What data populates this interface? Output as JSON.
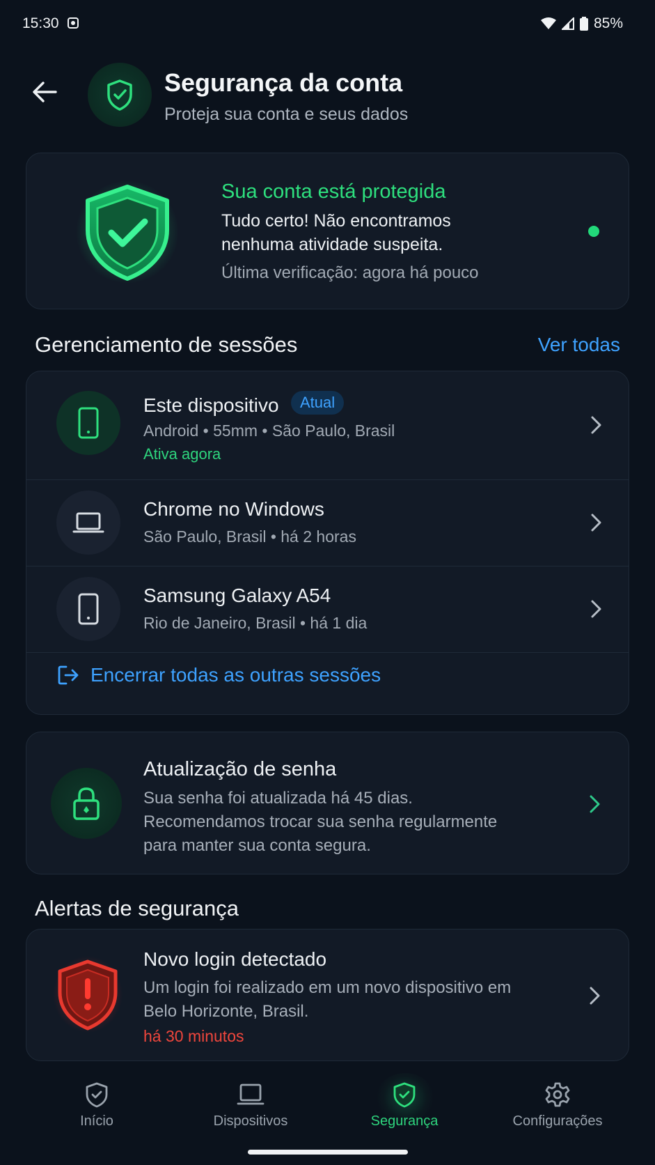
{
  "status_bar": {
    "time": "15:30",
    "battery": "85%"
  },
  "header": {
    "title": "Segurança da conta",
    "subtitle": "Proteja sua conta e seus dados"
  },
  "protection": {
    "title": "Sua conta está protegida",
    "body": "Tudo certo! Não encontramos nenhuma atividade suspeita.",
    "last_check": "Última verificação: agora há pouco"
  },
  "sessions": {
    "title": "Gerenciamento de sessões",
    "see_all": "Ver todas",
    "items": [
      {
        "name": "Este dispositivo",
        "badge": "Atual",
        "meta": "Android • 55mm • São Paulo, Brasil",
        "status": "Ativa agora",
        "icon": "smartphone-icon"
      },
      {
        "name": "Chrome no Windows",
        "meta": "São Paulo, Brasil • há 2 horas",
        "icon": "laptop-icon"
      },
      {
        "name": "Samsung Galaxy A54",
        "meta": "Rio de Janeiro, Brasil • há 1 dia",
        "icon": "smartphone-icon"
      }
    ],
    "end_all": "Encerrar todas as outras sessões"
  },
  "password": {
    "title": "Atualização de senha",
    "body": "Sua senha foi atualizada há 45 dias. Recomendamos trocar sua senha regularmente para manter sua conta segura."
  },
  "alerts": {
    "title": "Alertas de segurança",
    "items": [
      {
        "title": "Novo login detectado",
        "body": "Um login foi realizado em um novo dispositivo em Belo Horizonte, Brasil.",
        "time": "há 30 minutos"
      }
    ]
  },
  "nav": {
    "items": [
      {
        "label": "Início",
        "icon": "shield-check-icon"
      },
      {
        "label": "Dispositivos",
        "icon": "laptop-icon"
      },
      {
        "label": "Segurança",
        "icon": "shield-check-icon",
        "active": true
      },
      {
        "label": "Configurações",
        "icon": "gear-icon"
      }
    ]
  },
  "colors": {
    "accent_green": "#2ee07e",
    "accent_blue": "#3ea2ff",
    "alert_red": "#f0463c",
    "background": "#0b121c"
  }
}
